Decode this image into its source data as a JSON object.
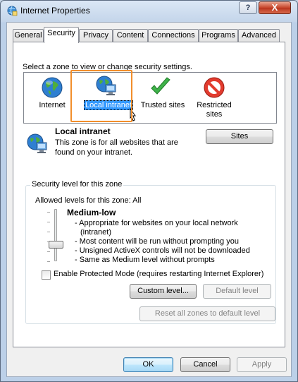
{
  "window": {
    "title": "Internet Properties",
    "help_label": "?",
    "close_label": "X"
  },
  "tabs": [
    "General",
    "Security",
    "Privacy",
    "Content",
    "Connections",
    "Programs",
    "Advanced"
  ],
  "active_tab": "Security",
  "zone_prompt": "Select a zone to view or change security settings.",
  "zones": [
    {
      "label": "Internet",
      "icon": "globe-icon"
    },
    {
      "label": "Local intranet",
      "icon": "intranet-icon",
      "selected": true
    },
    {
      "label": "Trusted sites",
      "icon": "checkmark-icon"
    },
    {
      "label_line1": "Restricted",
      "label_line2": "sites",
      "icon": "restricted-icon"
    }
  ],
  "zone_info": {
    "title": "Local intranet",
    "description_line1": "This zone is for all websites that are",
    "description_line2": "found on your intranet.",
    "sites_button": "Sites"
  },
  "security_level": {
    "group_title": "Security level for this zone",
    "allowed_levels": "Allowed levels for this zone: All",
    "level_name": "Medium-low",
    "level_fraction": 0.4,
    "bullets": [
      "- Appropriate for websites on your local network",
      "(intranet)",
      "- Most content will be run without prompting you",
      "- Unsigned ActiveX controls will not be downloaded",
      "- Same as Medium level without prompts"
    ],
    "protected_mode_label": "Enable Protected Mode (requires restarting Internet Explorer)",
    "protected_mode_checked": false,
    "custom_level_button": "Custom level...",
    "default_level_button": "Default level"
  },
  "reset_all_button": "Reset all zones to default level",
  "footer": {
    "ok": "OK",
    "cancel": "Cancel",
    "apply": "Apply"
  }
}
